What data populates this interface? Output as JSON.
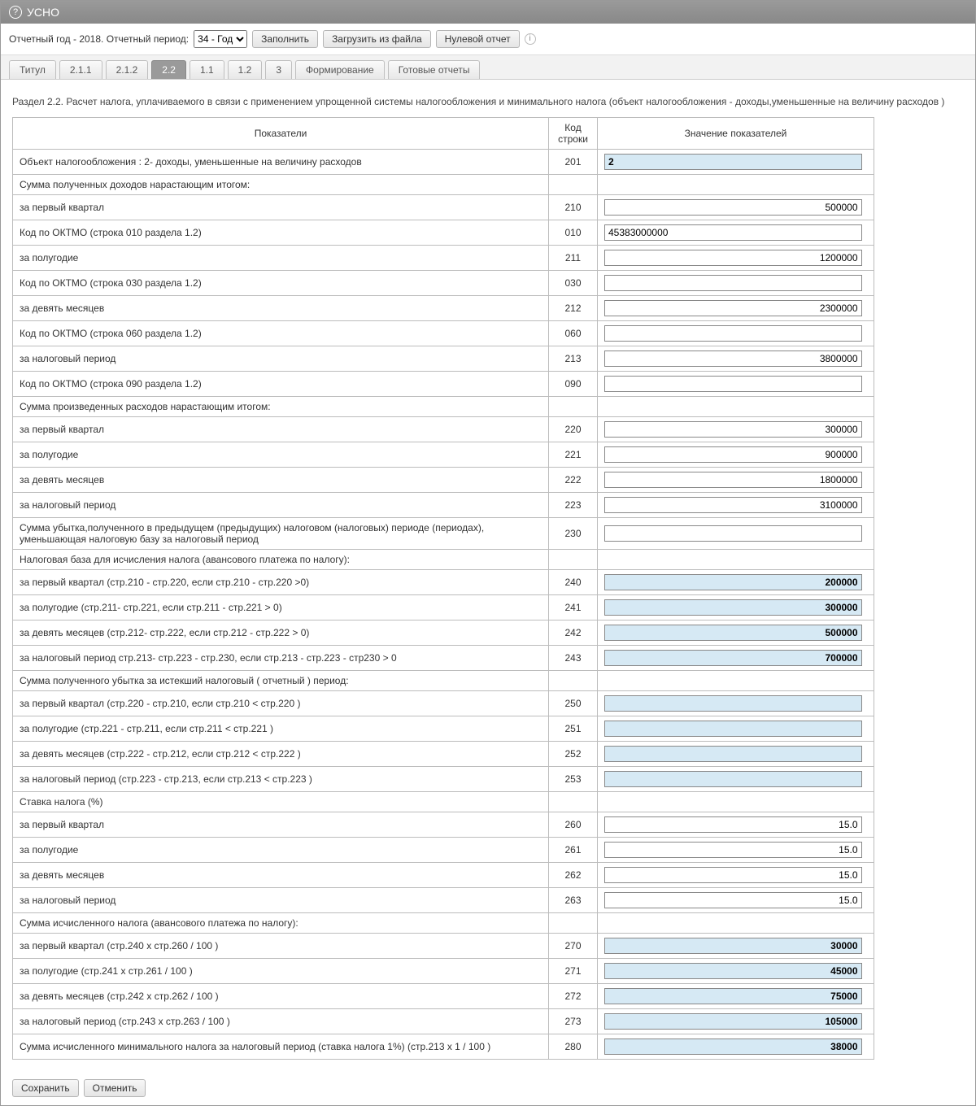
{
  "title": "УСНО",
  "toolbar": {
    "year_label": "Отчетный год - 2018.  Отчетный период:",
    "period_value": "34 - Год",
    "fill": "Заполнить",
    "upload": "Загрузить из файла",
    "zero": "Нулевой отчет"
  },
  "tabs": [
    "Титул",
    "2.1.1",
    "2.1.2",
    "2.2",
    "1.1",
    "1.2",
    "3",
    "Формирование",
    "Готовые отчеты"
  ],
  "active_tab": "2.2",
  "section_title": "Раздел 2.2. Расчет налога, уплачиваемого в связи с применением упрощенной системы налогообложения и минимального налога (объект налогообложения - доходы,уменьшенные на величину расходов )",
  "headers": {
    "c1": "Показатели",
    "c2": "Код строки",
    "c3": "Значение показателей"
  },
  "rows": [
    {
      "label": "Объект налогообложения : 2- доходы, уменьшенные на величину расходов",
      "code": "201",
      "value": "2",
      "ro": true,
      "align": "left"
    },
    {
      "label": "Сумма полученных доходов нарастающим итогом:",
      "code": "",
      "value": null
    },
    {
      "label": "за первый квартал",
      "code": "210",
      "value": "500000",
      "align": "right"
    },
    {
      "label": "Код по ОКТМО (строка 010 раздела 1.2)",
      "code": "010",
      "value": "45383000000",
      "align": "left"
    },
    {
      "label": "за полугодие",
      "code": "211",
      "value": "1200000",
      "align": "right"
    },
    {
      "label": "Код по ОКТМО (строка 030 раздела 1.2)",
      "code": "030",
      "value": "",
      "align": "left"
    },
    {
      "label": "за девять месяцев",
      "code": "212",
      "value": "2300000",
      "align": "right"
    },
    {
      "label": "Код по ОКТМО (строка 060 раздела 1.2)",
      "code": "060",
      "value": "",
      "align": "left"
    },
    {
      "label": "за налоговый период",
      "code": "213",
      "value": "3800000",
      "align": "right"
    },
    {
      "label": "Код по ОКТМО (строка 090 раздела 1.2)",
      "code": "090",
      "value": "",
      "align": "left"
    },
    {
      "label": "Сумма произведенных расходов нарастающим итогом:",
      "code": "",
      "value": null
    },
    {
      "label": "за первый квартал",
      "code": "220",
      "value": "300000",
      "align": "right"
    },
    {
      "label": "за полугодие",
      "code": "221",
      "value": "900000",
      "align": "right"
    },
    {
      "label": "за девять месяцев",
      "code": "222",
      "value": "1800000",
      "align": "right"
    },
    {
      "label": "за налоговый период",
      "code": "223",
      "value": "3100000",
      "align": "right"
    },
    {
      "label": "Сумма убытка,полученного в предыдущем (предыдущих) налоговом (налоговых) периоде (периодах), уменьшающая налоговую базу за налоговый период",
      "code": "230",
      "value": "",
      "align": "right"
    },
    {
      "label": "Налоговая база для исчисления налога (авансового платежа по налогу):",
      "code": "",
      "value": null
    },
    {
      "label": "за первый квартал (стр.210 - стр.220, если стр.210 - стр.220 >0)",
      "code": "240",
      "value": "200000",
      "ro": true,
      "align": "right"
    },
    {
      "label": "за полугодие (стр.211- стр.221, если стр.211 - стр.221 > 0)",
      "code": "241",
      "value": "300000",
      "ro": true,
      "align": "right"
    },
    {
      "label": "за девять месяцев (стр.212- стр.222, если стр.212 - стр.222 > 0)",
      "code": "242",
      "value": "500000",
      "ro": true,
      "align": "right"
    },
    {
      "label": "за налоговый период стр.213- стр.223 - стр.230, если стр.213 - стр.223 - стр230 > 0",
      "code": "243",
      "value": "700000",
      "ro": true,
      "align": "right"
    },
    {
      "label": "Сумма полученного убытка за истекший налоговый ( отчетный ) период:",
      "code": "",
      "value": null
    },
    {
      "label": "за первый квартал (стр.220 - стр.210, если стр.210 < стр.220 )",
      "code": "250",
      "value": "",
      "ro": true,
      "align": "right"
    },
    {
      "label": "за полугодие (стр.221 - стр.211, если стр.211 < стр.221 )",
      "code": "251",
      "value": "",
      "ro": true,
      "align": "right"
    },
    {
      "label": "за девять месяцев (стр.222 - стр.212, если стр.212 < стр.222 )",
      "code": "252",
      "value": "",
      "ro": true,
      "align": "right"
    },
    {
      "label": "за налоговый период (стр.223 - стр.213, если стр.213 < стр.223 )",
      "code": "253",
      "value": "",
      "ro": true,
      "align": "right"
    },
    {
      "label": "Ставка налога (%)",
      "code": "",
      "value": null
    },
    {
      "label": "за первый квартал",
      "code": "260",
      "value": "15.0",
      "align": "right"
    },
    {
      "label": "за полугодие",
      "code": "261",
      "value": "15.0",
      "align": "right"
    },
    {
      "label": "за девять месяцев",
      "code": "262",
      "value": "15.0",
      "align": "right"
    },
    {
      "label": "за налоговый период",
      "code": "263",
      "value": "15.0",
      "align": "right"
    },
    {
      "label": "Сумма исчисленного налога (авансового платежа по налогу):",
      "code": "",
      "value": null
    },
    {
      "label": "за первый квартал (стр.240 x стр.260 / 100 )",
      "code": "270",
      "value": "30000",
      "ro": true,
      "align": "right"
    },
    {
      "label": "за полугодие (стр.241 x стр.261 / 100 )",
      "code": "271",
      "value": "45000",
      "ro": true,
      "align": "right"
    },
    {
      "label": "за девять месяцев (стр.242 x стр.262 / 100 )",
      "code": "272",
      "value": "75000",
      "ro": true,
      "align": "right"
    },
    {
      "label": "за налоговый период (стр.243 x стр.263 / 100 )",
      "code": "273",
      "value": "105000",
      "ro": true,
      "align": "right"
    },
    {
      "label": "Сумма исчисленного минимального налога за налоговый период (ставка налога 1%) (стр.213 x 1 / 100 )",
      "code": "280",
      "value": "38000",
      "ro": true,
      "align": "right"
    }
  ],
  "footer": {
    "save": "Сохранить",
    "cancel": "Отменить"
  }
}
